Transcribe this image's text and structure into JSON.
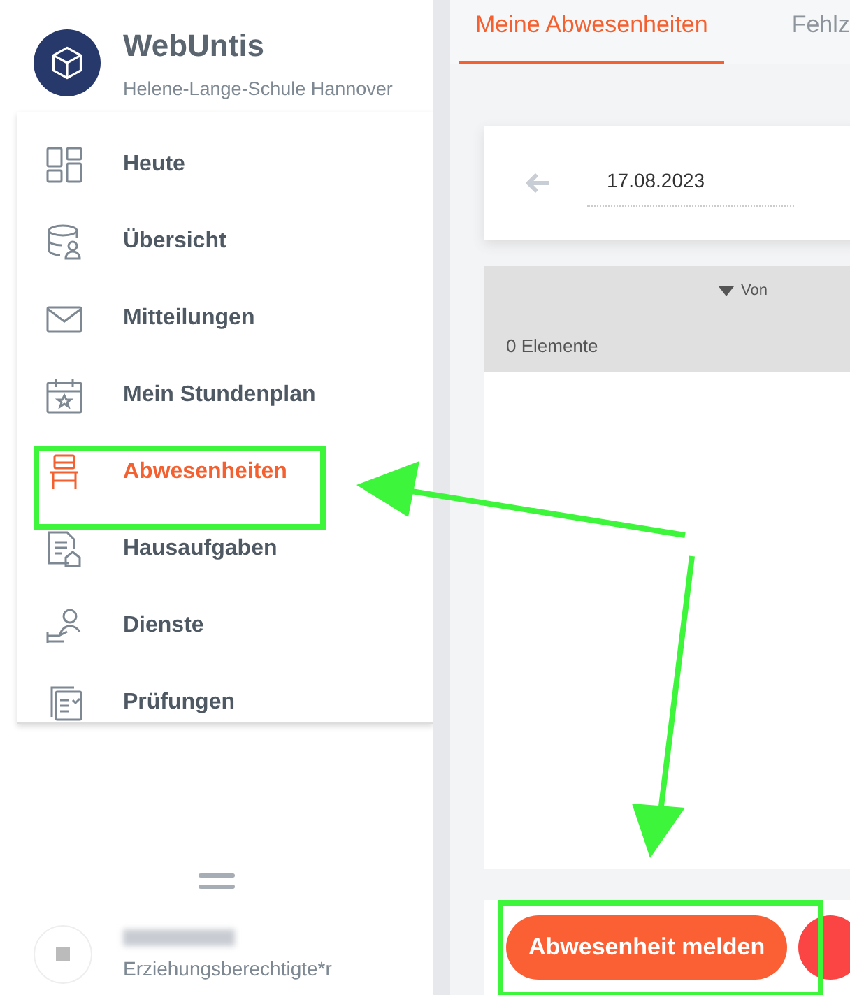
{
  "app": {
    "name": "WebUntis",
    "school": "Helene-Lange-Schule Hannover"
  },
  "nav": [
    {
      "label": "Heute",
      "kind": "dashboard",
      "selected": false
    },
    {
      "label": "Übersicht",
      "kind": "overview",
      "selected": false
    },
    {
      "label": "Mitteilungen",
      "kind": "mail",
      "selected": false
    },
    {
      "label": "Mein Stundenplan",
      "kind": "calendar",
      "selected": false
    },
    {
      "label": "Abwesenheiten",
      "kind": "chair",
      "selected": true
    },
    {
      "label": "Hausaufgaben",
      "kind": "homework",
      "selected": false
    },
    {
      "label": "Dienste",
      "kind": "duty",
      "selected": false
    },
    {
      "label": "Prüfungen",
      "kind": "exams",
      "selected": false
    }
  ],
  "user": {
    "role": "Erziehungsberechtigte*r"
  },
  "tabs": [
    {
      "label": "Meine Abwesenheiten",
      "selected": true
    },
    {
      "label": "Fehlz",
      "selected": false
    }
  ],
  "date": "17.08.2023",
  "table": {
    "columns": [
      "Von"
    ],
    "count": "0 Elemente"
  },
  "buttons": [
    "Abwesenheit melden"
  ]
}
